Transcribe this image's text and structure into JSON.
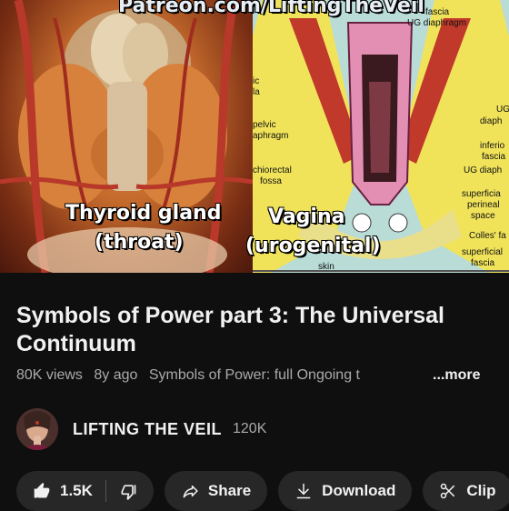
{
  "video": {
    "watermark": "Patreon.com/LiftingTheVeil",
    "left_caption_line1": "Thyroid gland",
    "left_caption_line2": "(throat)",
    "right_caption_line1": "Vagina",
    "right_caption_line2": "(urogenital)",
    "diagram_labels": {
      "fascia_top": "fascia",
      "ug_diaphragm": "UG diaphragm",
      "pelvic_diaphragm_1": "pelvic",
      "pelvic_diaphragm_2": "aphragm",
      "ischiorectal_1": "chiorectal",
      "ischiorectal_2": "fossa",
      "ug_right": "UG",
      "diaph_right": "diaph",
      "inferior": "inferio",
      "fascia_r": "fascia",
      "ug_diaph_r": "UG diaph",
      "superficial_perineal_1": "superficia",
      "superficial_perineal_2": "perineal",
      "superficial_perineal_3": "space",
      "colles": "Colles' fa",
      "superficial_fascia_1": "superficial",
      "superficial_fascia_2": "fascia",
      "skin": "skin",
      "ic": "ic",
      "la": "la"
    }
  },
  "title": "Symbols of Power part 3: The Universal Continuum",
  "meta": {
    "views": "80K views",
    "age": "8y ago",
    "description_snippet": "Symbols of Power:  full Ongoing t",
    "more_label": "...more"
  },
  "channel": {
    "name": "LIFTING THE VEIL",
    "subscribers": "120K"
  },
  "actions": {
    "like_count": "1.5K",
    "share_label": "Share",
    "download_label": "Download",
    "clip_label": "Clip"
  }
}
